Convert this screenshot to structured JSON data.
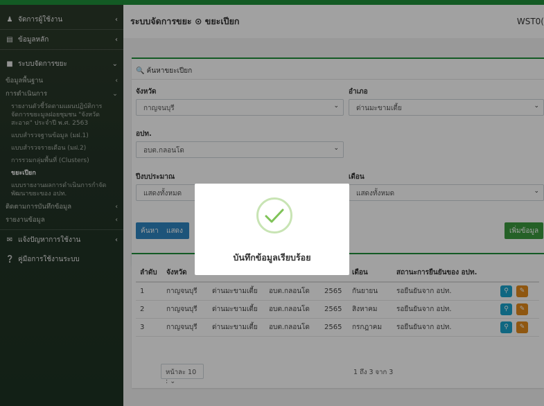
{
  "sidebar": {
    "items": [
      {
        "icon": "user-icon",
        "label": "จัดการผู้ใช้งาน"
      },
      {
        "icon": "database-icon",
        "label": "ข้อมูลหลัก"
      },
      {
        "icon": "trash-icon",
        "label": "ระบบจัดการขยะ"
      }
    ],
    "sub": {
      "basic": "ข้อมูลพื้นฐาน",
      "operations": "การดำเนินการ",
      "ops_items": [
        "รายงานตัวชี้วัดตามแผนปฏิบัติการจัดการขยะมูลฝอยชุมชน \"จังหวัดสะอาด\" ประจำปี พ.ศ. 2563",
        "แบบสำรวจฐานข้อมูล (มฝ.1)",
        "แบบสำรวจรายเดือน (มฝ.2)",
        "การรวมกลุ่มพื้นที่ (Clusters)",
        "ขยะเปียก",
        "แบบรายงานผลการดำเนินการกำจัดพัฒนาขยะของ อปท."
      ],
      "tracking": "ติดตามการบันทึกข้อมูล",
      "report": "รายงานข้อมูล"
    },
    "bottom": [
      {
        "icon": "mail-icon",
        "label": "แจ้งปัญหาการใช้งาน"
      },
      {
        "icon": "help-icon",
        "label": "คู่มือการใช้งานระบบ"
      }
    ]
  },
  "header": {
    "title": "ระบบจัดการขยะ ⊙ ขยะเปียก",
    "user": "WST0("
  },
  "search": {
    "title": "ค้นหาขยะเปียก",
    "province_label": "จังหวัด",
    "province_value": "กาญจนบุรี",
    "district_label": "อำเภอ",
    "district_value": "ด่านมะขามเตี้ย",
    "lao_label": "อปท.",
    "lao_value": "อบต.กลอนโด",
    "fiscal_label": "ปีงบประมาณ",
    "fiscal_value": "แสดงทั้งหมด",
    "month_label": "เดือน",
    "month_value": "แสดงทั้งหมด",
    "search_button": "ค้นหา",
    "show_all_button": "แสดง",
    "add_button": "เพิ่มข้อมูล"
  },
  "table": {
    "headers": [
      "ลำดับ",
      "จังหวัด",
      "",
      "",
      "",
      "เดือน",
      "สถานะการยืนยันของ อปท.",
      ""
    ],
    "rows": [
      [
        "1",
        "กาญจนบุรี",
        "ด่านมะขามเตี้ย",
        "อบต.กลอนโด",
        "2565",
        "กันยายน",
        "รอยืนยันจาก อปท."
      ],
      [
        "2",
        "กาญจนบุรี",
        "ด่านมะขามเตี้ย",
        "อบต.กลอนโด",
        "2565",
        "สิงหาคม",
        "รอยืนยันจาก อปท."
      ],
      [
        "3",
        "กาญจนบุรี",
        "ด่านมะขามเตี้ย",
        "อบต.กลอนโด",
        "2565",
        "กรกฎาคม",
        "รอยืนยันจาก อปท."
      ]
    ],
    "page_size": "หน้าละ 10 :",
    "range": "1 ถึง 3 จาก 3"
  },
  "modal": {
    "message": "บันทึกข้อมูลเรียบร้อย",
    "icon": "check-icon"
  },
  "colors": {
    "accent": "#1f8f3a",
    "primary_button": "#2e86c1",
    "add_button": "#3b9a3e",
    "view_action": "#1aa3cc",
    "edit_action": "#e38b1b",
    "check": "#7fc358"
  }
}
